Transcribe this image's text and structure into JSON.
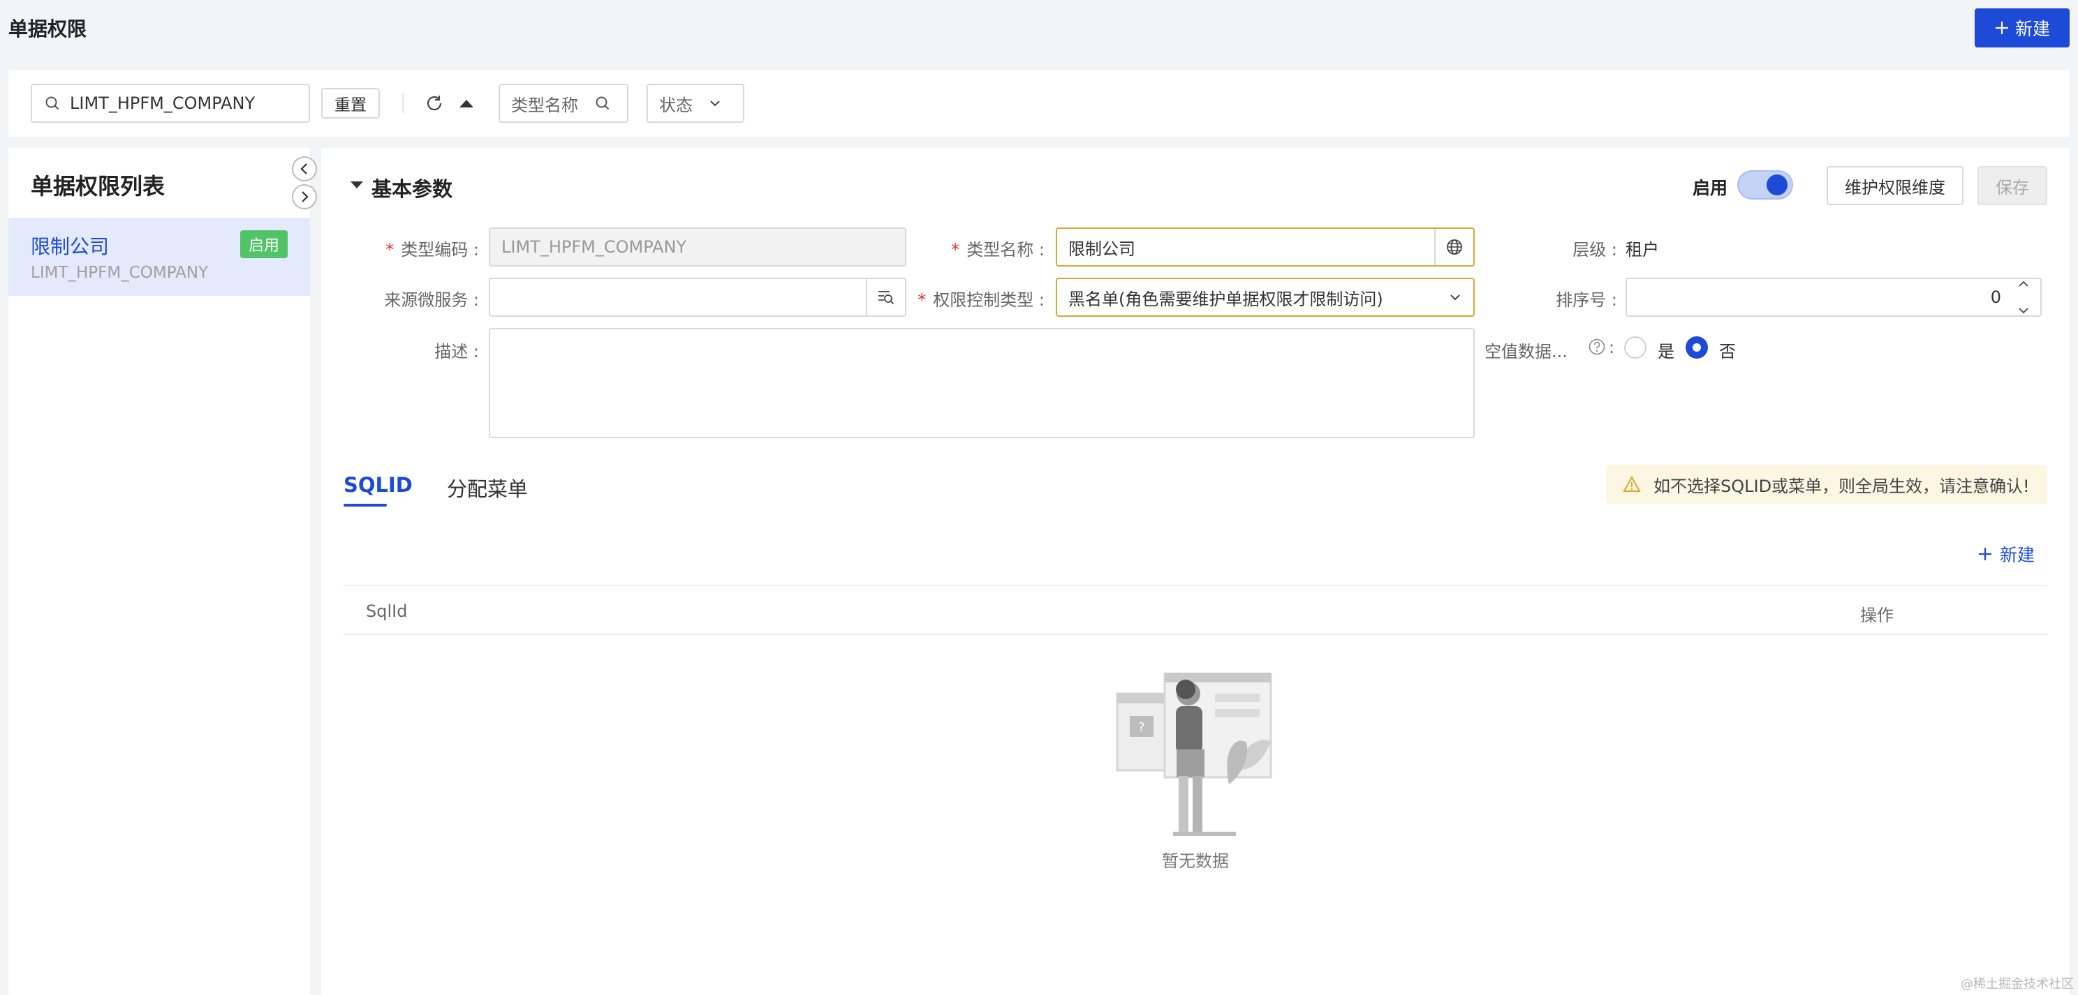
{
  "header": {
    "title": "单据权限",
    "new_button": "新建"
  },
  "filters": {
    "search_value": "LIMT_HPFM_COMPANY",
    "reset_label": "重置",
    "type_name_placeholder": "类型名称",
    "status_placeholder": "状态"
  },
  "list": {
    "title": "单据权限列表",
    "items": [
      {
        "name": "限制公司",
        "code": "LIMT_HPFM_COMPANY",
        "badge": "启用"
      }
    ]
  },
  "section": {
    "title": "基本参数",
    "enable_label": "启用",
    "enabled": true,
    "maintain_button": "维护权限维度",
    "save_button": "保存"
  },
  "form": {
    "type_code_label": "类型编码",
    "type_code_value": "LIMT_HPFM_COMPANY",
    "type_name_label": "类型名称",
    "type_name_value": "限制公司",
    "level_label": "层级",
    "level_value": "租户",
    "source_label": "来源微服务",
    "source_value": "",
    "control_type_label": "权限控制类型",
    "control_type_value": "黑名单(角色需要维护单据权限才限制访问)",
    "sort_label": "排序号",
    "sort_value": "0",
    "desc_label": "描述",
    "desc_value": "",
    "null_data_label": "空值数据...",
    "yes_label": "是",
    "no_label": "否",
    "selected": "否"
  },
  "tabs": [
    {
      "label": "SQLID",
      "active": true
    },
    {
      "label": "分配菜单",
      "active": false
    }
  ],
  "warning": "如不选择SQLID或菜单，则全局生效，请注意确认!",
  "sub_new_button": "新建",
  "table": {
    "columns": [
      "SqlId",
      "操作"
    ],
    "empty_text": "暂无数据"
  },
  "watermark": "@稀土掘金技术社区",
  "colors": {
    "primary": "#1e4ad8",
    "success": "#52c468",
    "warning": "#d8a83a"
  }
}
